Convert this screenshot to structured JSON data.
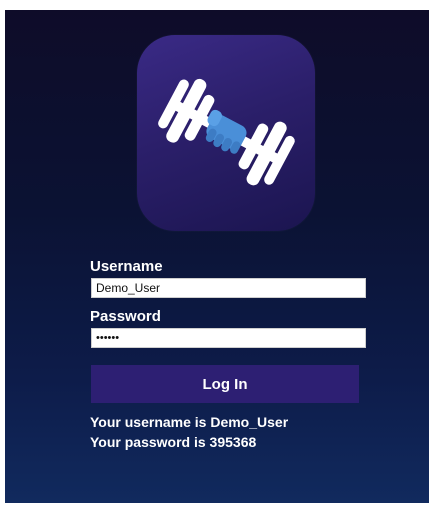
{
  "login": {
    "username_label": "Username",
    "username_value": "Demo_User",
    "password_label": "Password",
    "password_value": "395368",
    "button_label": "Log In",
    "status_username": "Your username is Demo_User",
    "status_password": "Your password is 395368"
  },
  "logo": {
    "icon": "dumbbell-fist-icon",
    "background_color": "#2b1f6a",
    "plate_color": "#ffffff",
    "hand_color": "#4a8fd8"
  },
  "colors": {
    "page_background": "#0b1233",
    "button_background": "#2d1f73",
    "text": "#ffffff"
  }
}
